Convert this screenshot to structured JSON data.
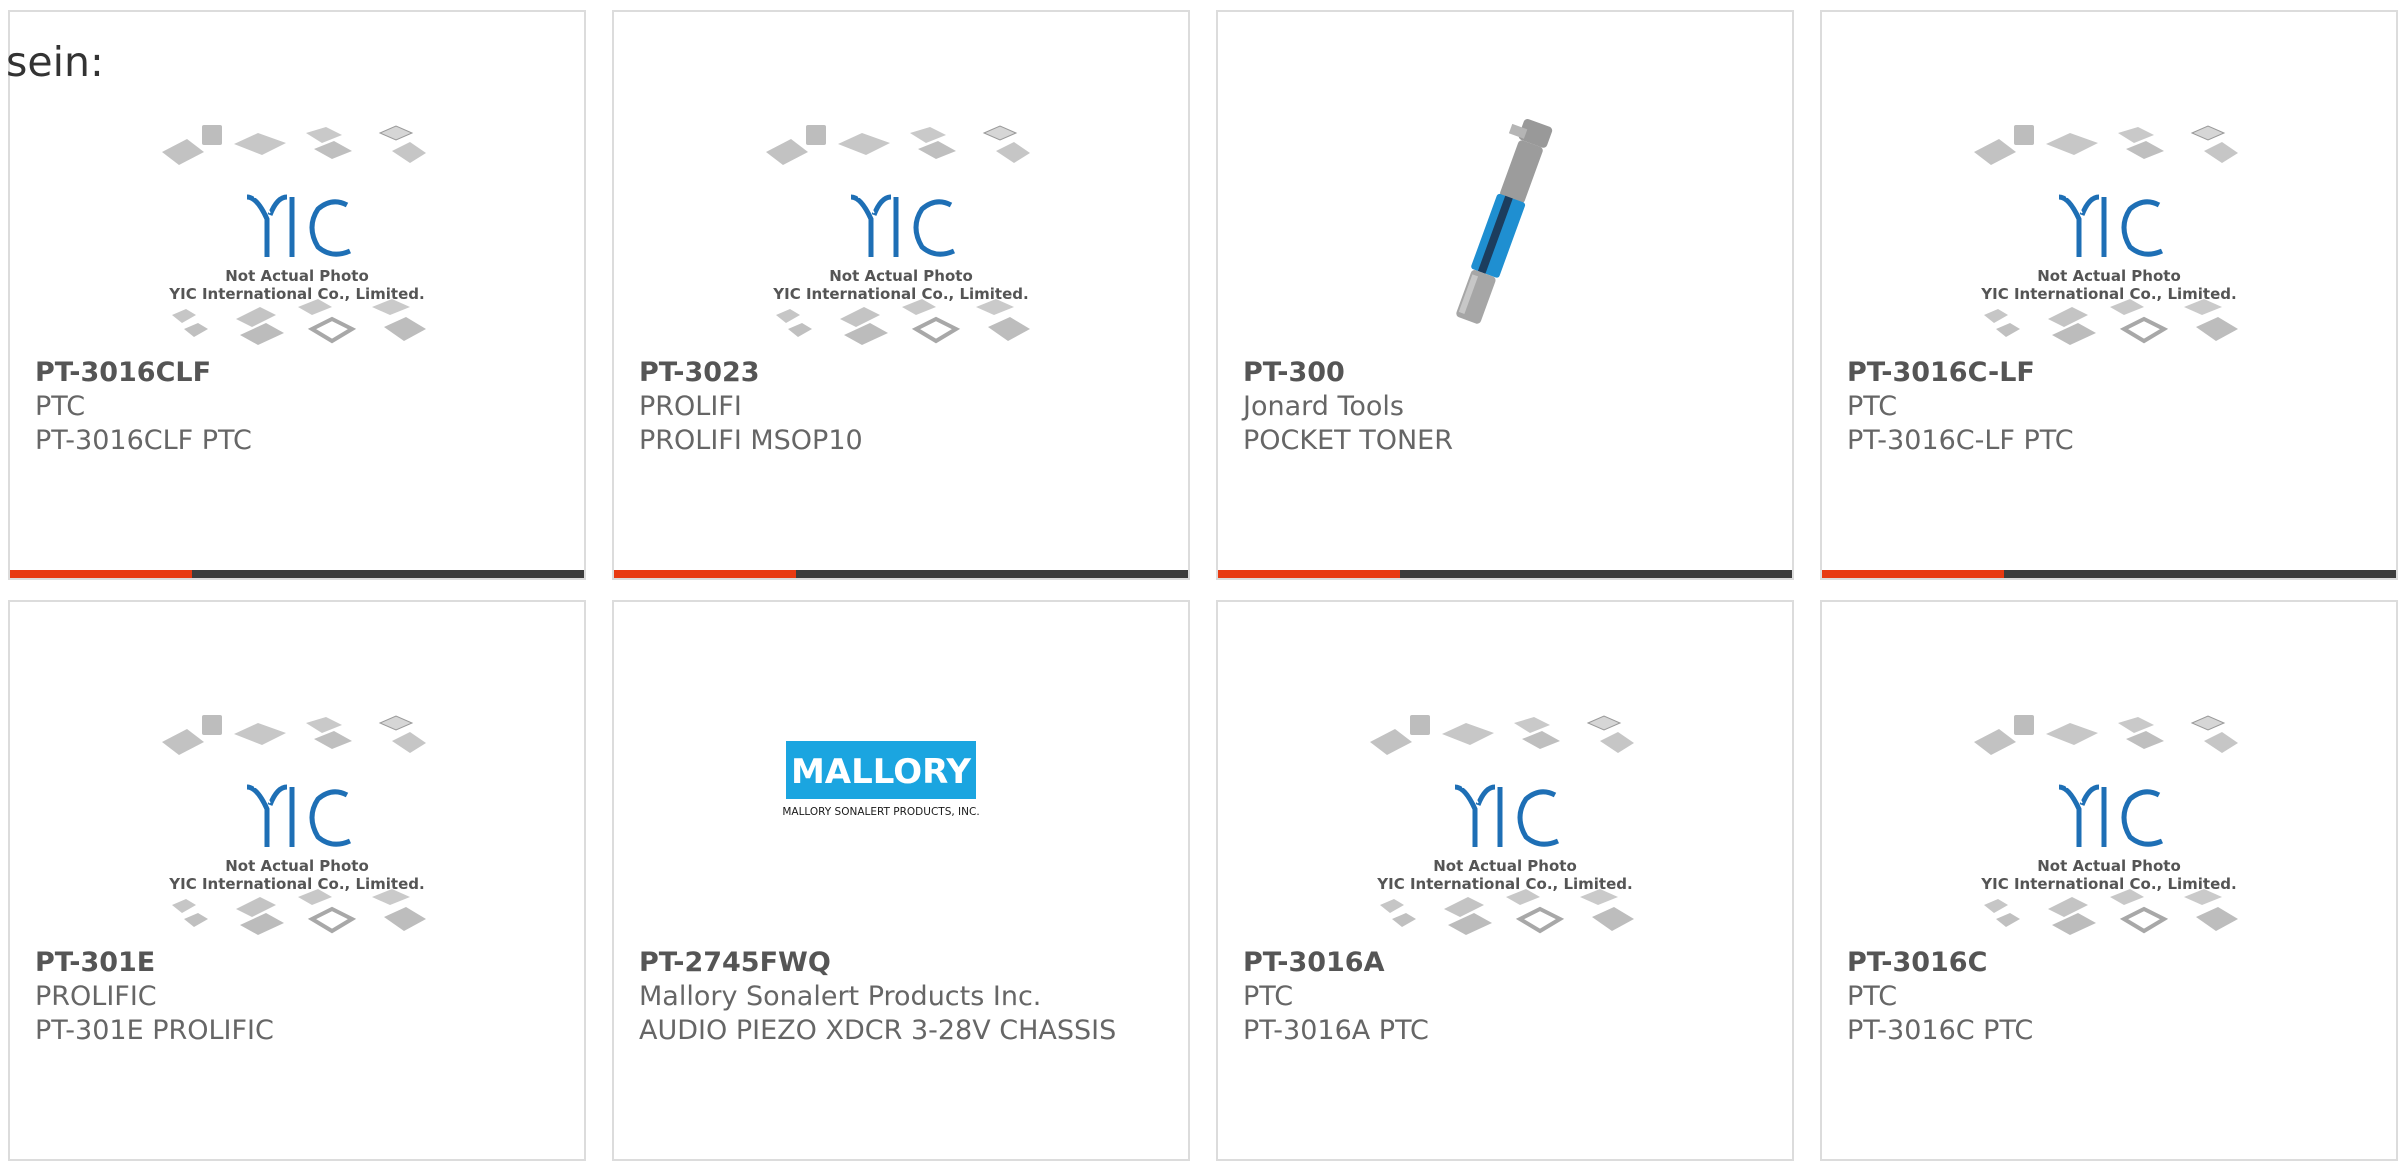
{
  "intro": "sein:",
  "placeholder_photo": {
    "logo": "YIC",
    "line1": "Not Actual Photo",
    "line2": "YIC International Co., Limited."
  },
  "brand_colors": {
    "accent": "#e83a12",
    "bar": "#3d3d3d",
    "yic_blue": "#1e6fb5",
    "mallory_blue": "#1ba5e0"
  },
  "products": [
    {
      "part": "PT-3016CLF",
      "maker": "PTC",
      "desc": "PT-3016CLF PTC",
      "image": "placeholder"
    },
    {
      "part": "PT-3023",
      "maker": "PROLIFI",
      "desc": "PROLIFI MSOP10",
      "image": "placeholder"
    },
    {
      "part": "PT-300",
      "maker": "Jonard Tools",
      "desc": "POCKET TONER",
      "image": "tool-photo"
    },
    {
      "part": "PT-3016C-LF",
      "maker": "PTC",
      "desc": "PT-3016C-LF PTC",
      "image": "placeholder"
    },
    {
      "part": "PT-301E",
      "maker": "PROLIFIC",
      "desc": "PT-301E PROLIFIC",
      "image": "placeholder"
    },
    {
      "part": "PT-2745FWQ",
      "maker": "Mallory Sonalert Products Inc.",
      "desc": "AUDIO PIEZO XDCR 3-28V CHASSIS",
      "image": "mallory-logo"
    },
    {
      "part": "PT-3016A",
      "maker": "PTC",
      "desc": "PT-3016A PTC",
      "image": "placeholder"
    },
    {
      "part": "PT-3016C",
      "maker": "PTC",
      "desc": "PT-3016C PTC",
      "image": "placeholder"
    }
  ],
  "mallory_logo": {
    "name": "MALLORY",
    "tagline": "MALLORY SONALERT PRODUCTS, INC."
  }
}
